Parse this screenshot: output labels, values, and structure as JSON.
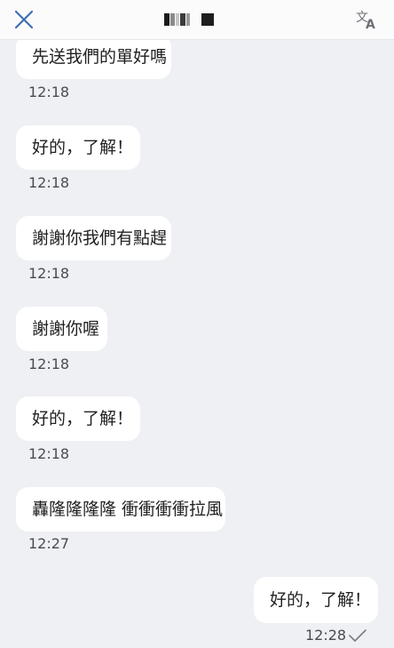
{
  "header": {
    "close_icon": "close-icon",
    "translate_icon": "translate-icon"
  },
  "messages": [
    {
      "text": "先送我們的單好嗎",
      "time": "12:18",
      "side": "incoming"
    },
    {
      "text": "好的，了解！",
      "time": "12:18",
      "side": "incoming"
    },
    {
      "text": "謝謝你我們有點趕",
      "time": "12:18",
      "side": "incoming"
    },
    {
      "text": "謝謝你喔",
      "time": "12:18",
      "side": "incoming"
    },
    {
      "text": "好的，了解！",
      "time": "12:18",
      "side": "incoming"
    },
    {
      "text": "轟隆隆隆隆 衝衝衝衝拉風",
      "time": "12:27",
      "side": "incoming"
    },
    {
      "text": "好的，了解！",
      "time": "12:28",
      "side": "outgoing",
      "status": "sent"
    }
  ],
  "colors": {
    "background": "#eef0f4",
    "bubble": "#ffffff",
    "accent_close": "#3f6fb4"
  }
}
